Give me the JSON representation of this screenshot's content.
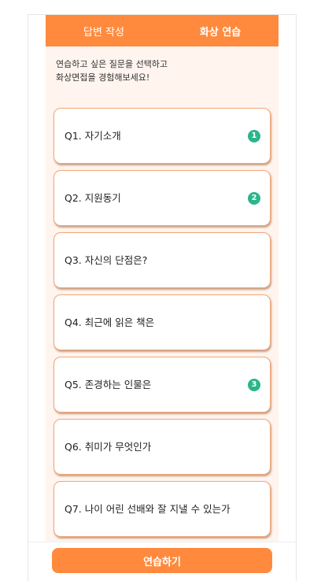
{
  "tabs": [
    {
      "label": "답변 작성",
      "active": false
    },
    {
      "label": "화상 연습",
      "active": true
    }
  ],
  "intro": {
    "line1": "연습하고 싶은 질문을 선택하고",
    "line2": "화상면접을 경험해보세요!"
  },
  "questions": [
    {
      "label": "Q1. 자기소개",
      "badge": "1"
    },
    {
      "label": "Q2. 지원동기",
      "badge": "2"
    },
    {
      "label": "Q3. 자신의 단점은?",
      "badge": null
    },
    {
      "label": "Q4. 최근에 읽은 책은",
      "badge": null
    },
    {
      "label": "Q5. 존경하는 인물은",
      "badge": "3"
    },
    {
      "label": "Q6. 취미가 무엇인가",
      "badge": null
    },
    {
      "label": "Q7. 나이 어린 선배와 잘 지낼 수 있는가",
      "badge": null
    },
    {
      "label": "",
      "badge": null
    }
  ],
  "practice_button": {
    "label": "연습하기"
  },
  "colors": {
    "accent": "#ff8a3d",
    "badge": "#2bb58a",
    "panel": "#fff4ee"
  }
}
